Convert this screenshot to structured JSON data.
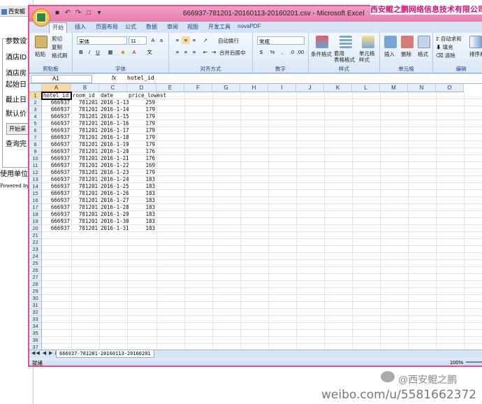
{
  "background_window": {
    "tab_title": "西安鲲",
    "form_rows": [
      "参数设",
      "酒店ID",
      "酒店房",
      "起始日",
      "截止日",
      "默认价"
    ],
    "button1": "开始采",
    "row_query": "查询完",
    "footer_user": "使用单位",
    "footer_powered": "Powered by"
  },
  "watermark_top": "西安鲲之鹏网络信息技术有限公司",
  "excel": {
    "title": "666937-781201-20160113-20160201.csv - Microsoft Excel",
    "tabs": [
      "开始",
      "插入",
      "页面布局",
      "公式",
      "数据",
      "审阅",
      "视图",
      "开发工具",
      "novaPDF"
    ],
    "active_tab": "开始",
    "ribbon": {
      "paste": "粘贴",
      "cut": "剪切",
      "copy": "复制",
      "format_painter": "格式刷",
      "clipboard_group": "剪贴板",
      "font_name": "宋体",
      "font_size": "11",
      "font_group": "字体",
      "wrap_text": "自动换行",
      "merge_center": "合并后居中",
      "align_group": "对齐方式",
      "number_format": "常规",
      "number_group": "数字",
      "cond_format": "条件格式",
      "table_format": "套用\n表格格式",
      "cell_style": "单元格\n样式",
      "style_group": "样式",
      "insert": "插入",
      "delete": "删除",
      "format": "格式",
      "cells_group": "单元格",
      "autosum": "自动求和",
      "fill": "填充",
      "clear": "清除",
      "sort_filter": "排序和",
      "edit_group": "编辑"
    },
    "name_box": "A1",
    "fx": "fx",
    "formula": "hotel_id",
    "columns": [
      "A",
      "B",
      "C",
      "D",
      "E",
      "F",
      "G",
      "H",
      "I",
      "J",
      "K",
      "L",
      "M",
      "N",
      "O"
    ],
    "header_row": [
      "hotel_id",
      "room_id",
      "date",
      "price_lowest"
    ],
    "rows": [
      [
        "666937",
        "781201",
        "2016-1-13",
        "259"
      ],
      [
        "666937",
        "781201",
        "2016-1-14",
        "179"
      ],
      [
        "666937",
        "781201",
        "2016-1-15",
        "179"
      ],
      [
        "666937",
        "781201",
        "2016-1-16",
        "179"
      ],
      [
        "666937",
        "781201",
        "2016-1-17",
        "179"
      ],
      [
        "666937",
        "781201",
        "2016-1-18",
        "179"
      ],
      [
        "666937",
        "781201",
        "2016-1-19",
        "179"
      ],
      [
        "666937",
        "781201",
        "2016-1-20",
        "176"
      ],
      [
        "666937",
        "781201",
        "2016-1-21",
        "176"
      ],
      [
        "666937",
        "781201",
        "2016-1-22",
        "169"
      ],
      [
        "666937",
        "781201",
        "2016-1-23",
        "179"
      ],
      [
        "666937",
        "781201",
        "2016-1-24",
        "183"
      ],
      [
        "666937",
        "781201",
        "2016-1-25",
        "183"
      ],
      [
        "666937",
        "781201",
        "2016-1-26",
        "183"
      ],
      [
        "666937",
        "781201",
        "2016-1-27",
        "183"
      ],
      [
        "666937",
        "781201",
        "2016-1-28",
        "183"
      ],
      [
        "666937",
        "781201",
        "2016-1-29",
        "183"
      ],
      [
        "666937",
        "781201",
        "2016-1-30",
        "183"
      ],
      [
        "666937",
        "781201",
        "2016-1-31",
        "183"
      ]
    ],
    "row_numbers": [
      "1",
      "2",
      "3",
      "4",
      "5",
      "6",
      "7",
      "8",
      "9",
      "10",
      "11",
      "12",
      "13",
      "14",
      "15",
      "16",
      "17",
      "18",
      "19",
      "20",
      "21",
      "22",
      "23",
      "24",
      "25",
      "26",
      "27",
      "28",
      "29",
      "30",
      "31",
      "32",
      "33",
      "34",
      "35",
      "36",
      "37"
    ],
    "sheet_nav": "◀◀ ◀ ▶ ▶▶",
    "sheet_tab": "666937-781201-20160113-20160201",
    "status": "就绪",
    "zoom": "100%"
  },
  "bottom_watermark": "weibo.com/u/5581662372",
  "bottom_watermark_name": "@西安鲲之鹏"
}
